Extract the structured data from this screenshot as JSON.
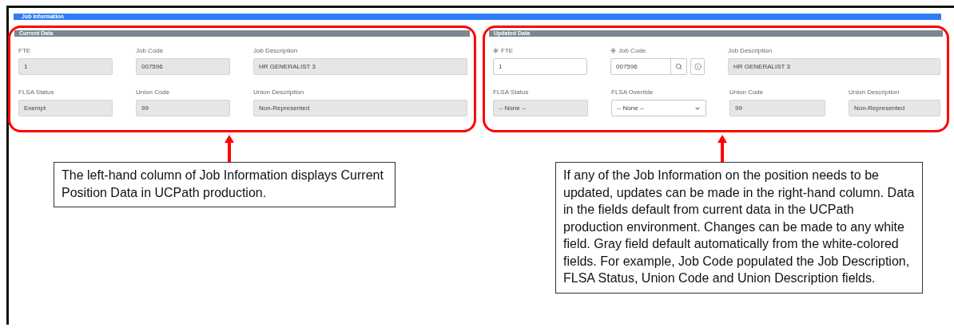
{
  "header": {
    "title": "Job Information"
  },
  "panels": [
    {
      "title": "Current Data",
      "rows": [
        [
          {
            "label": "FTE",
            "value": "1",
            "kind": "readonly",
            "required": false
          },
          {
            "label": "Job Code",
            "value": "007596",
            "kind": "readonly",
            "required": false
          },
          {
            "label": "Job Description",
            "value": "HR GENERALIST 3",
            "kind": "readonly",
            "required": false
          }
        ],
        [
          {
            "label": "FLSA Status",
            "value": "Exempt",
            "kind": "readonly",
            "required": false
          },
          {
            "label": "Union Code",
            "value": "99",
            "kind": "readonly",
            "required": false
          },
          {
            "label": "Union Description",
            "value": "Non-Represented",
            "kind": "readonly",
            "required": false
          }
        ]
      ]
    },
    {
      "title": "Updated Data",
      "rows": [
        [
          {
            "label": "FTE",
            "value": "1",
            "kind": "text",
            "required": true
          },
          {
            "label": "Job Code",
            "value": "007596",
            "kind": "lookup",
            "required": true
          },
          {
            "label": "Job Description",
            "value": "HR GENERALIST 3",
            "kind": "readonly",
            "required": false
          }
        ],
        [
          {
            "label": "FLSA Status",
            "value": "-- None --",
            "kind": "readonly",
            "required": false
          },
          {
            "label": "FLSA Override",
            "value": "-- None --",
            "kind": "select",
            "required": false
          },
          {
            "label": "Union Code",
            "value": "99",
            "kind": "readonly",
            "required": false
          },
          {
            "label": "Union Description",
            "value": "Non-Represented",
            "kind": "readonly",
            "required": false
          }
        ]
      ]
    }
  ],
  "callouts": [
    {
      "text": "The left-hand column of Job Information displays Current Position Data in UCPath production."
    },
    {
      "text": "If any of the Job Information on the position needs to be updated, updates can be made in the right-hand column. Data in the fields default from current data in the UCPath production environment. Changes can be made to any white field. Gray field default automatically from the white-colored fields. For example, Job Code populated the Job Description, FLSA Status, Union Code and Union Description fields."
    }
  ]
}
